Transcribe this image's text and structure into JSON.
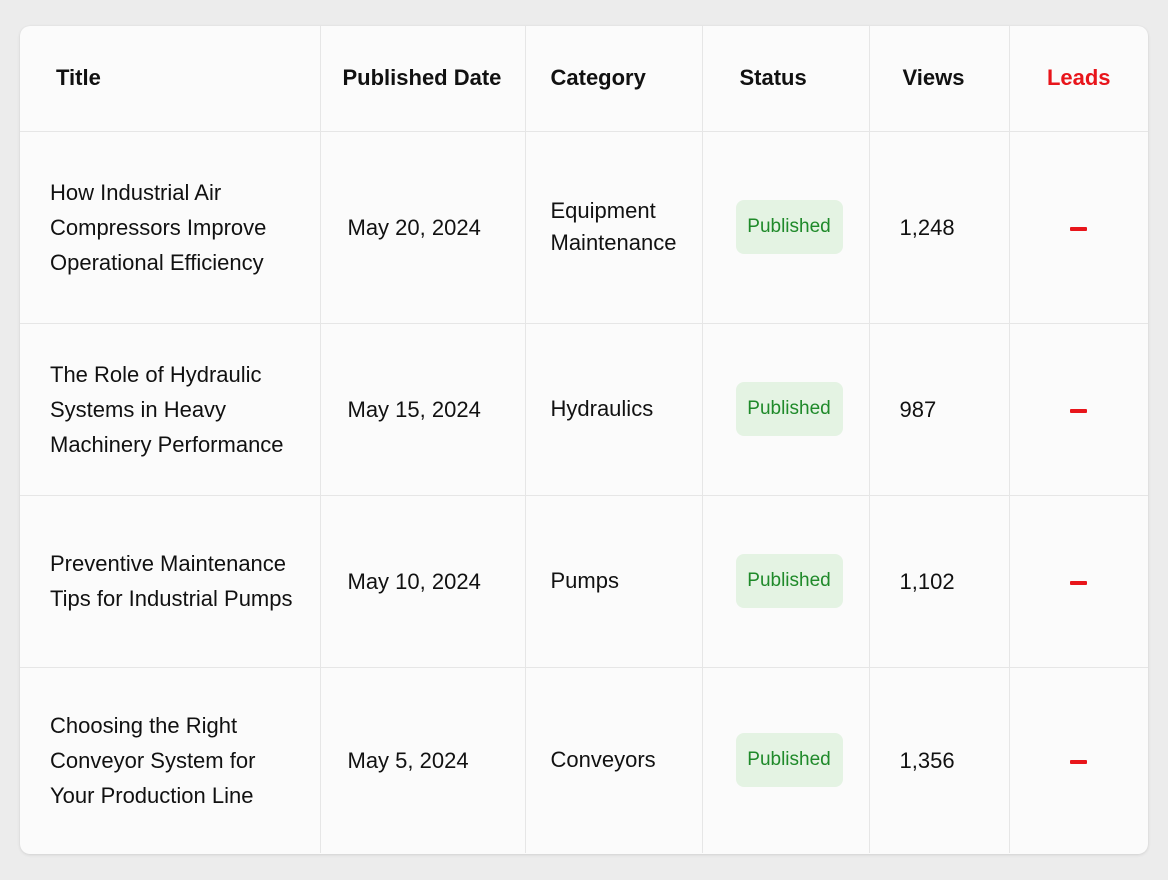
{
  "table": {
    "headers": {
      "title": "Title",
      "published_date": "Published Date",
      "category": "Category",
      "status": "Status",
      "views": "Views",
      "leads": "Leads"
    },
    "rows": [
      {
        "title": "How Industrial Air Compressors Improve Operational Efficiency",
        "published_date": "May 20, 2024",
        "category": "Equipment Maintenance",
        "status": "Published",
        "views": "1,248",
        "leads_icon": "dash-icon"
      },
      {
        "title": "The Role of Hydraulic Systems in Heavy Machinery Performance",
        "published_date": "May 15, 2024",
        "category": "Hydraulics",
        "status": "Published",
        "views": "987",
        "leads_icon": "dash-icon"
      },
      {
        "title": "Preventive Maintenance Tips for Industrial Pumps",
        "published_date": "May 10, 2024",
        "category": "Pumps",
        "status": "Published",
        "views": "1,102",
        "leads_icon": "dash-icon"
      },
      {
        "title": "Choosing the Right Conveyor System for Your Production Line",
        "published_date": "May 5, 2024",
        "category": "Conveyors",
        "status": "Published",
        "views": "1,356",
        "leads_icon": "dash-icon"
      }
    ]
  },
  "colors": {
    "leads_accent": "#e8151b",
    "status_text": "#1f8a2a",
    "status_bg": "#e4f3e3",
    "card_bg": "#fbfbfb",
    "page_bg": "#ececec"
  }
}
